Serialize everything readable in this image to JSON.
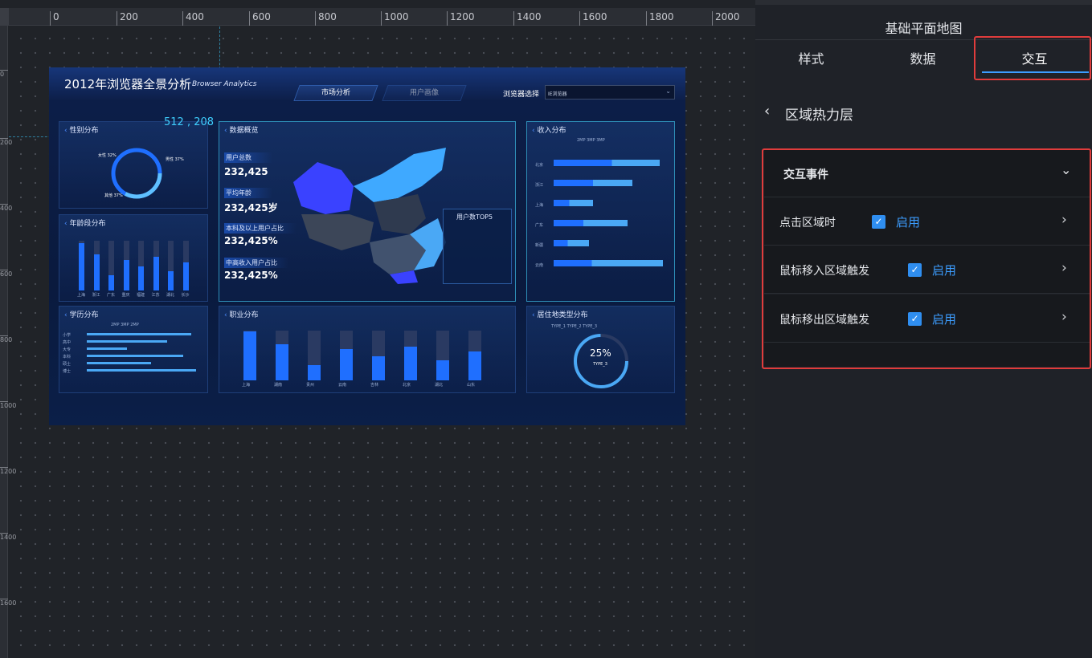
{
  "ruler": {
    "top_ticks": [
      "0",
      "200",
      "400",
      "600",
      "800",
      "1000",
      "1200",
      "1400",
      "1600",
      "1800",
      "2000"
    ],
    "left_ticks": [
      "0",
      "200",
      "400",
      "600",
      "800",
      "1000",
      "1200",
      "1400",
      "1600"
    ]
  },
  "coord_readout": "512 , 208",
  "dashboard": {
    "title": "2012年浏览器全景分析",
    "subtitle": "Browser Analytics",
    "nav": [
      "市场分析",
      "用户画像"
    ],
    "selector_label": "浏览器选择",
    "selector_value": "IE浏览器",
    "panels": {
      "gender": {
        "title": "性别分布",
        "labels": [
          "女性\n32%",
          "男性\n37%",
          "其他\n37%"
        ]
      },
      "overview": {
        "title": "数据概览",
        "stats": [
          {
            "label": "用户总数",
            "value": "232,425"
          },
          {
            "label": "平均年龄",
            "value": "232,425岁"
          },
          {
            "label": "本科及以上用户占比",
            "value": "232,425%"
          },
          {
            "label": "中高收入用户占比",
            "value": "232,425%"
          }
        ],
        "top5_title": "用户数TOP5"
      },
      "income": {
        "title": "收入分布",
        "legend": [
          "2MP",
          "3MP",
          "3MP"
        ],
        "rows": [
          "北京",
          "浙江",
          "上海",
          "广东",
          "新疆",
          "云南"
        ]
      },
      "age": {
        "title": "年龄段分布",
        "cats": [
          "上海",
          "浙江",
          "广东",
          "重庆",
          "福建",
          "江苏",
          "湖北",
          "长沙"
        ],
        "values": [
          0.95,
          0.72,
          0.3,
          0.62,
          0.48,
          0.67,
          0.38,
          0.57
        ]
      },
      "edu": {
        "title": "学历分布",
        "legend": [
          "2MP",
          "3MP",
          "2MP"
        ],
        "rows": [
          "小学",
          "高中",
          "大专",
          "本科",
          "硕士",
          "博士"
        ]
      },
      "job": {
        "title": "职业分布",
        "cats": [
          "上海",
          "湖南",
          "贵州",
          "云南",
          "吉林",
          "北京",
          "湖北",
          "山东"
        ],
        "values": [
          0.98,
          0.73,
          0.3,
          0.63,
          0.48,
          0.68,
          0.4,
          0.58
        ]
      },
      "living": {
        "title": "居住地类型分布",
        "legend": [
          "TYPE_1",
          "TYPE_2",
          "TYPE_3"
        ],
        "center_value": "25%",
        "center_label": "TYPE_3"
      }
    }
  },
  "panel": {
    "title": "基础平面地图",
    "tabs": [
      "样式",
      "数据",
      "交互"
    ],
    "active_tab": "交互",
    "back_title": "区域热力层",
    "section_title": "交互事件",
    "rows": [
      {
        "label": "点击区域时",
        "enable": "启用"
      },
      {
        "label": "鼠标移入区域触发",
        "enable": "启用"
      },
      {
        "label": "鼠标移出区域触发",
        "enable": "启用"
      }
    ]
  },
  "colors": {
    "accent": "#2f8ef0",
    "highlight_red": "#e03c3c",
    "chart_blue": "#1f6fff"
  }
}
